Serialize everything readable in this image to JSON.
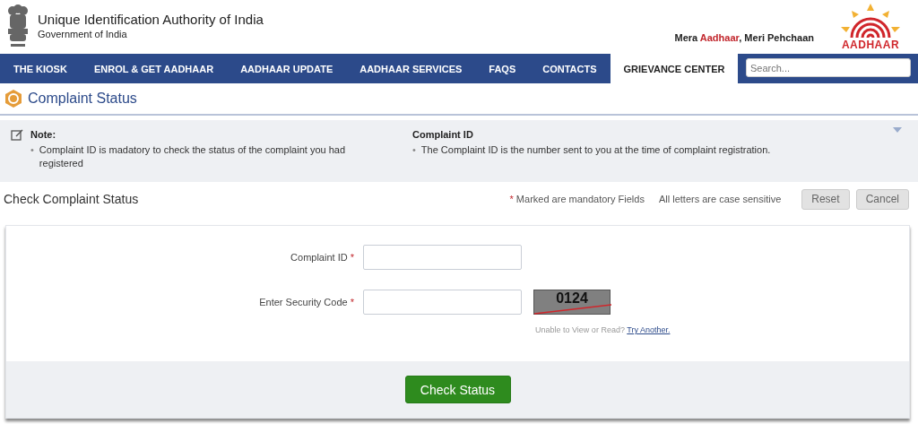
{
  "header": {
    "org_name": "Unique Identification Authority of India",
    "org_sub": "Government of India",
    "tagline": [
      {
        "text": "Mera ",
        "kind": "plain"
      },
      {
        "text": "Aadhaar",
        "kind": "highlight"
      },
      {
        "text": ", Meri Pehchaan",
        "kind": "plain"
      }
    ],
    "logo_text": "AADHAAR"
  },
  "nav": {
    "items": [
      {
        "label": "THE KIOSK",
        "selected": false
      },
      {
        "label": "ENROL & GET AADHAAR",
        "selected": false
      },
      {
        "label": "AADHAAR UPDATE",
        "selected": false
      },
      {
        "label": "AADHAAR SERVICES",
        "selected": false
      },
      {
        "label": "FAQS",
        "selected": false
      },
      {
        "label": "CONTACTS",
        "selected": false
      },
      {
        "label": "GRIEVANCE CENTER",
        "selected": true
      }
    ],
    "search": {
      "placeholder": "Search..."
    }
  },
  "page_title": "Complaint Status",
  "note_panel": {
    "bullet_mark": "•",
    "columns": [
      {
        "title": "Note:",
        "bullets": [
          "Complaint ID is madatory to check the status of the complaint you had registered"
        ]
      },
      {
        "title": "Complaint ID",
        "bullets": [
          "The Complaint ID is the number sent to you at the time of complaint registration."
        ]
      }
    ]
  },
  "form_header": {
    "title": "Check Complaint Status",
    "required_mark": "*",
    "required_note": "Marked are mandatory Fields",
    "case_note": "All letters are case sensitive",
    "buttons": [
      "Reset",
      "Cancel"
    ]
  },
  "form": {
    "fields": [
      {
        "label": "Complaint ID",
        "required": true,
        "kind": "text"
      },
      {
        "label": "Enter Security Code",
        "required": true,
        "kind": "captcha",
        "captcha_text": "0124",
        "help": "Unable to View or Read?",
        "help_link": "Try Another."
      }
    ],
    "required_mark": "*",
    "submit": "Check Status"
  }
}
